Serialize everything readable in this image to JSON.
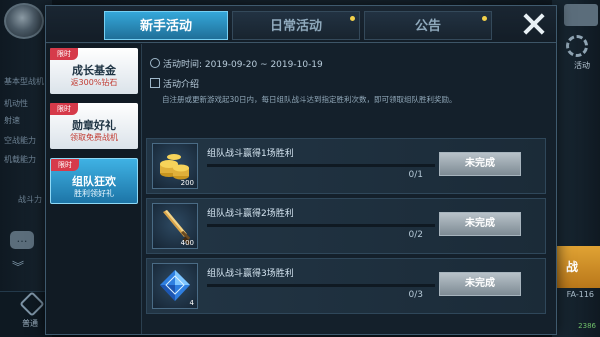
{
  "background": {
    "left_labels": [
      "基本型战机",
      "机动性",
      "射速",
      "空战能力",
      "机载能力",
      "战斗力"
    ],
    "bottom_left_label": "普通",
    "right_top_label": "活动",
    "fight_button": "战",
    "plane_code": "FA-116",
    "tokens": "2386"
  },
  "modal": {
    "tabs": [
      {
        "label": "新手活动",
        "active": true,
        "dot": false
      },
      {
        "label": "日常活动",
        "active": false,
        "dot": true
      },
      {
        "label": "公告",
        "active": false,
        "dot": true
      }
    ],
    "sidebar": [
      {
        "tag": "限时",
        "title": "成长基金",
        "subtitle": "返300%钻石",
        "active": false
      },
      {
        "tag": "限时",
        "title": "勋章好礼",
        "subtitle": "领取免费战机",
        "active": false
      },
      {
        "tag": "限时",
        "title": "组队狂欢",
        "subtitle": "胜利领好礼",
        "active": true
      }
    ],
    "content": {
      "time_label": "活动时间: 2019-09-20 ~ 2019-10-19",
      "intro_label": "活动介绍",
      "description": "自注册或更新游戏起30日内，每日组队战斗达到指定胜利次数，即可领取组队胜利奖励。",
      "tasks": [
        {
          "icon": "gold-coins-icon",
          "quantity": "200",
          "title": "组队战斗赢得1场胜利",
          "progress": "0/1",
          "button": "未完成"
        },
        {
          "icon": "sword-icon",
          "quantity": "400",
          "title": "组队战斗赢得2场胜利",
          "progress": "0/2",
          "button": "未完成"
        },
        {
          "icon": "blue-diamond-icon",
          "quantity": "4",
          "title": "组队战斗赢得3场胜利",
          "progress": "0/3",
          "button": "未完成"
        }
      ]
    }
  },
  "colors": {
    "active_tab": "#35a7d9",
    "limited_tag": "#d63a4a",
    "incomplete_button": "#9aa6ae"
  }
}
